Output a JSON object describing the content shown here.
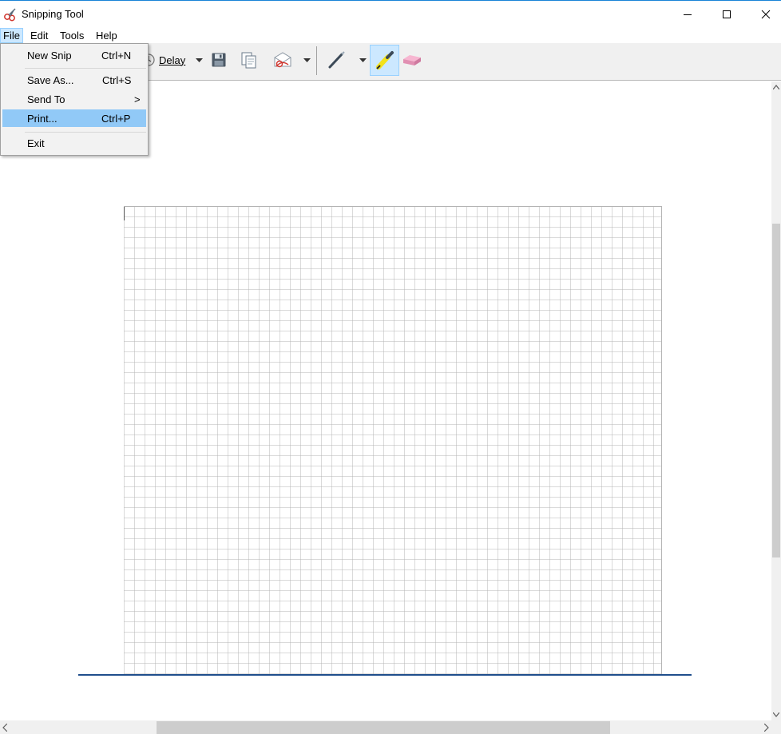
{
  "window": {
    "title": "Snipping Tool",
    "app_icon": "scissors-icon",
    "controls": [
      "minimize-icon",
      "maximize-icon",
      "close-icon"
    ]
  },
  "menubar": {
    "items": [
      {
        "label": "File"
      },
      {
        "label": "Edit"
      },
      {
        "label": "Tools"
      },
      {
        "label": "Help"
      }
    ],
    "active": "File"
  },
  "toolbar": {
    "delay_label": "Delay",
    "active_tool": "highlighter",
    "tools": [
      "delay-clock-icon",
      "save-icon",
      "copy-icon",
      "send-snip-icon",
      "pen-icon",
      "highlighter-icon",
      "eraser-icon"
    ]
  },
  "file_menu": {
    "items": [
      {
        "label": "New Snip",
        "shortcut": "Ctrl+N"
      },
      {
        "label": "Save As...",
        "shortcut": "Ctrl+S"
      },
      {
        "label": "Send To",
        "submenu_arrow": ">"
      },
      {
        "label": "Print...",
        "shortcut": "Ctrl+P",
        "highlighted": true
      },
      {
        "label": "Exit"
      }
    ]
  },
  "colors": {
    "title_accent": "#1883d7",
    "menu_highlight": "#91c9f7",
    "toolbar_active": "#cce8ff",
    "grid_line": "#b4b4b4",
    "baseline": "#1f4e8c"
  }
}
